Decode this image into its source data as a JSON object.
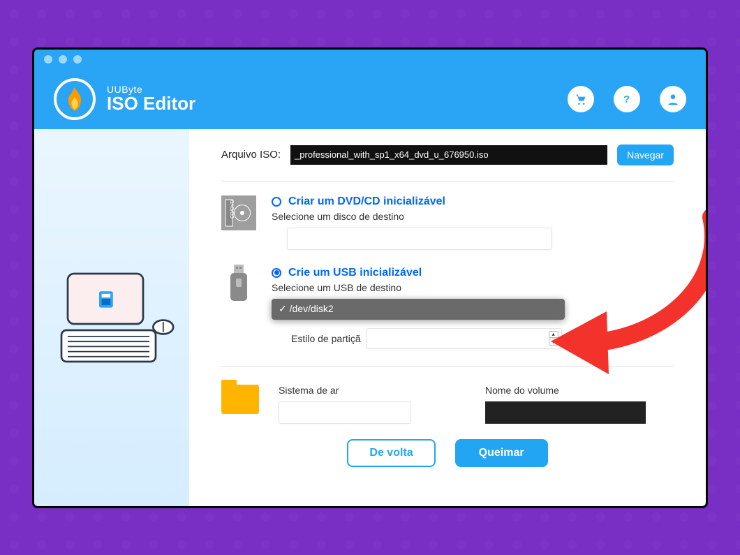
{
  "header": {
    "brand_small": "UUByte",
    "brand_big": "ISO Editor"
  },
  "iso": {
    "label": "Arquivo ISO:",
    "filename": "_professional_with_sp1_x64_dvd_u_676950.iso",
    "browse": "Navegar"
  },
  "optionDvd": {
    "title": "Criar um DVD/CD inicializável",
    "subtitle": "Selecione um disco de destino"
  },
  "optionUsb": {
    "title": "Crie um USB inicializável",
    "subtitle": "Selecione um USB de destino",
    "selected": "✓ /dev/disk2",
    "partition_label": "Estilo de partiçã"
  },
  "fs": {
    "label": "Sistema de ar"
  },
  "vol": {
    "label": "Nome do volume"
  },
  "actions": {
    "back": "De volta",
    "burn": "Queimar"
  }
}
